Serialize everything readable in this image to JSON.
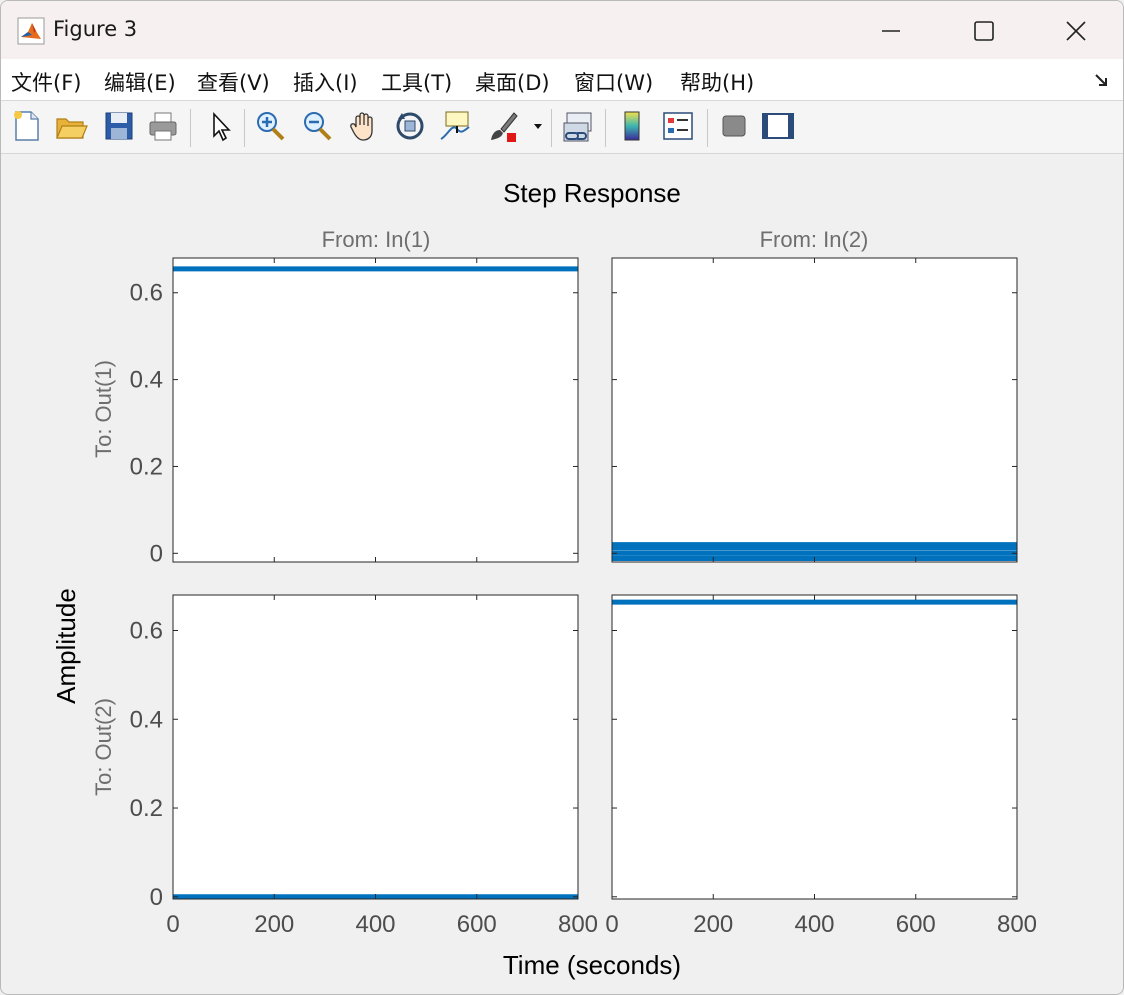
{
  "window": {
    "title": "Figure 3",
    "controls": [
      "minimize",
      "maximize",
      "close"
    ]
  },
  "menu": {
    "items": [
      "文件(F)",
      "编辑(E)",
      "查看(V)",
      "插入(I)",
      "工具(T)",
      "桌面(D)",
      "窗口(W)",
      "帮助(H)"
    ]
  },
  "toolbar": {
    "buttons": [
      "new-figure-icon",
      "open-file-icon",
      "save-icon",
      "print-icon",
      "pointer-icon",
      "zoom-in-icon",
      "zoom-out-icon",
      "pan-hand-icon",
      "rotate-3d-icon",
      "data-cursor-icon",
      "brush-icon",
      "brush-dropdown-icon",
      "link-plot-icon",
      "colorbar-icon",
      "legend-icon",
      "hide-plot-tools-icon",
      "show-plot-tools-icon"
    ]
  },
  "figure": {
    "title": "Step Response",
    "xlabel": "Time (seconds)",
    "ylabel": "Amplitude",
    "column_titles": [
      "From: In(1)",
      "From: In(2)"
    ],
    "row_labels": [
      "To: Out(1)",
      "To: Out(2)"
    ],
    "line_color": "#0072bd"
  },
  "chart_data": {
    "type": "line",
    "title": "Step Response",
    "xlabel": "Time (seconds)",
    "ylabel": "Amplitude",
    "xlim": [
      0,
      800
    ],
    "xticks": [
      0,
      200,
      400,
      600,
      800
    ],
    "xtick_labels": [
      "0",
      "200",
      "400",
      "600",
      "800"
    ],
    "grid": false,
    "subplots": [
      {
        "row": 1,
        "col": 1,
        "from": "In(1)",
        "to": "Out(1)",
        "ylim": [
          -0.02,
          0.68
        ],
        "yticks": [
          0,
          0.2,
          0.4,
          0.6
        ],
        "ytick_labels": [
          "0",
          "0.2",
          "0.4",
          "0.6"
        ],
        "lines": [
          {
            "x": [
              0,
              800
            ],
            "y": [
              0.655,
              0.655
            ]
          }
        ]
      },
      {
        "row": 1,
        "col": 2,
        "from": "In(2)",
        "to": "Out(1)",
        "ylim": [
          -0.02,
          0.68
        ],
        "yticks": [
          0,
          0.2,
          0.4,
          0.6
        ],
        "ytick_labels": [
          "0",
          "0.2",
          "0.4",
          "0.6"
        ],
        "lines": [
          {
            "x": [
              0,
              800
            ],
            "y": [
              0.02,
              0.02
            ]
          },
          {
            "x": [
              0,
              800
            ],
            "y": [
              0.012,
              0.012
            ]
          },
          {
            "x": [
              0,
              800
            ],
            "y": [
              0.0,
              0.0
            ]
          },
          {
            "x": [
              0,
              800
            ],
            "y": [
              -0.012,
              -0.012
            ]
          }
        ]
      },
      {
        "row": 2,
        "col": 1,
        "from": "In(1)",
        "to": "Out(2)",
        "ylim": [
          -0.005,
          0.68
        ],
        "yticks": [
          0,
          0.2,
          0.4,
          0.6
        ],
        "ytick_labels": [
          "0",
          "0.2",
          "0.4",
          "0.6"
        ],
        "lines": [
          {
            "x": [
              0,
              800
            ],
            "y": [
              0.0,
              0.0
            ]
          }
        ]
      },
      {
        "row": 2,
        "col": 2,
        "from": "In(2)",
        "to": "Out(2)",
        "ylim": [
          -0.005,
          0.68
        ],
        "yticks": [
          0,
          0.2,
          0.4,
          0.6
        ],
        "ytick_labels": [
          "0",
          "0.2",
          "0.4",
          "0.6"
        ],
        "lines": [
          {
            "x": [
              0,
              800
            ],
            "y": [
              0.664,
              0.664
            ]
          }
        ]
      }
    ]
  }
}
